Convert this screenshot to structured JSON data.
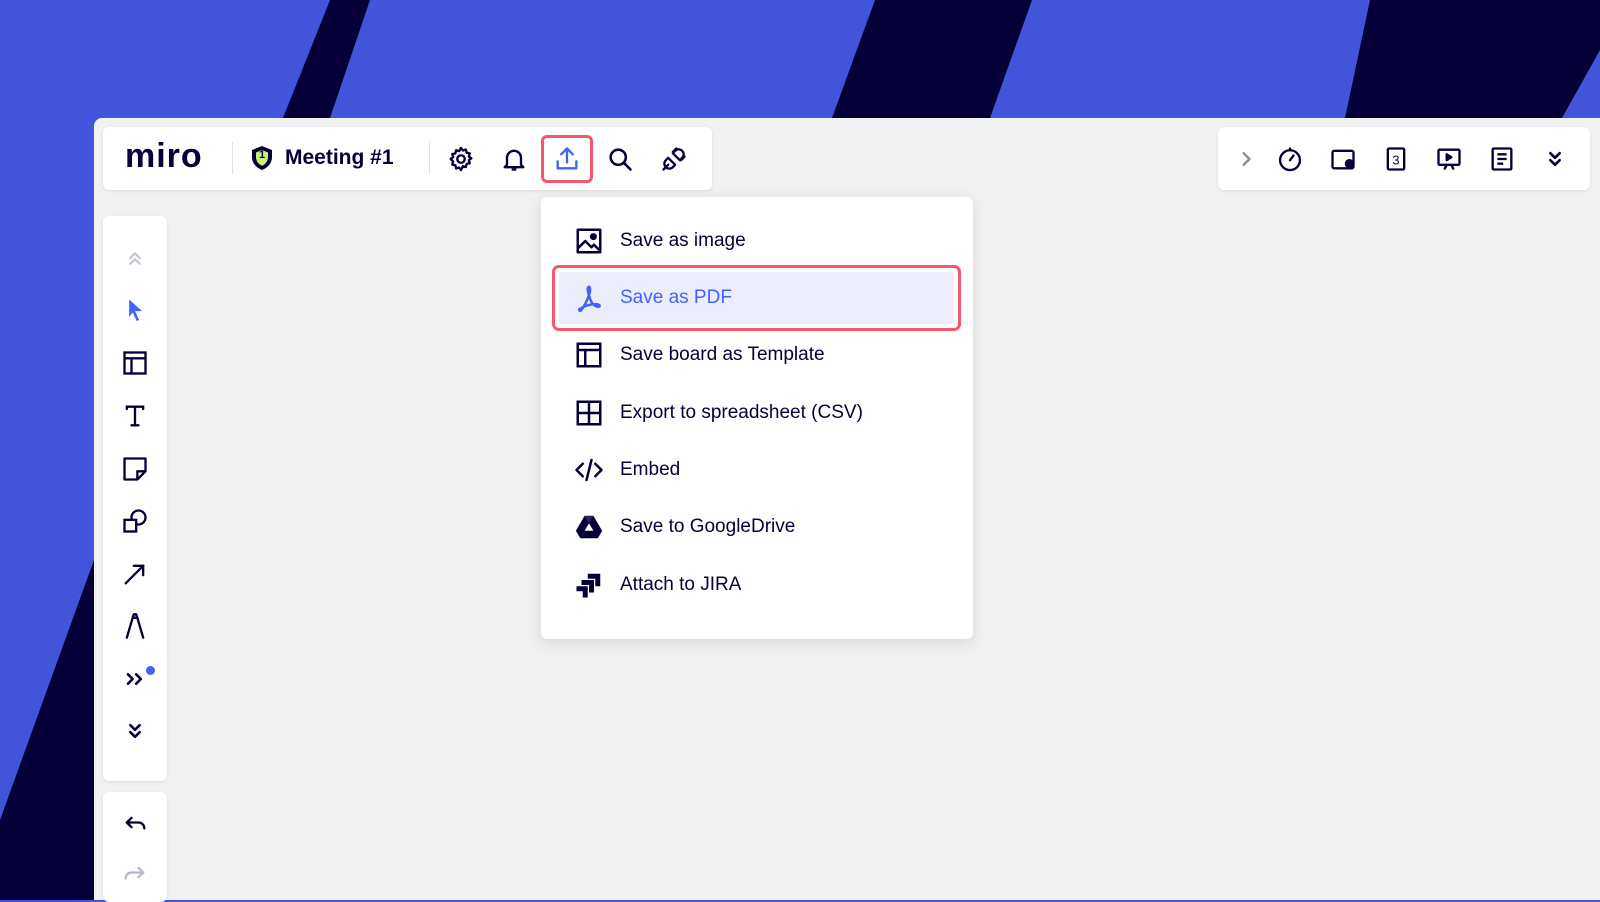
{
  "app": {
    "logo_text": "miro",
    "board_name": "Meeting #1",
    "shield_badge": "1"
  },
  "toolbar": {
    "icons": [
      "gear-icon",
      "bell-icon",
      "upload-icon",
      "search-icon",
      "plug-icon"
    ]
  },
  "right_toolbar": {
    "icons": [
      "chevron-right-icon",
      "timer-icon",
      "card-icon",
      "countdown-icon",
      "presentation-icon",
      "notes-icon",
      "chevrons-down-icon"
    ],
    "countdown_digit": "3"
  },
  "left_toolbar": {
    "icons": [
      "chevrons-up-icon",
      "cursor-icon",
      "frame-icon",
      "text-icon",
      "sticky-note-icon",
      "shapes-icon",
      "arrow-icon",
      "pen-icon",
      "more-apps-icon",
      "chevrons-down-icon"
    ],
    "undo_icons": [
      "undo-icon",
      "redo-icon"
    ]
  },
  "export_menu": {
    "items": [
      {
        "label": "Save as image",
        "icon": "image-icon"
      },
      {
        "label": "Save as PDF",
        "icon": "pdf-icon",
        "active": true
      },
      {
        "label": "Save board as Template",
        "icon": "template-icon"
      },
      {
        "label": "Export to spreadsheet (CSV)",
        "icon": "table-icon"
      },
      {
        "label": "Embed",
        "icon": "code-icon"
      },
      {
        "label": "Save to GoogleDrive",
        "icon": "google-drive-icon"
      },
      {
        "label": "Attach to JIRA",
        "icon": "jira-icon"
      }
    ]
  },
  "colors": {
    "background_blue": "#4254d9",
    "stripe_navy": "#050038",
    "accent": "#4262ff",
    "highlight": "#f0596a"
  }
}
